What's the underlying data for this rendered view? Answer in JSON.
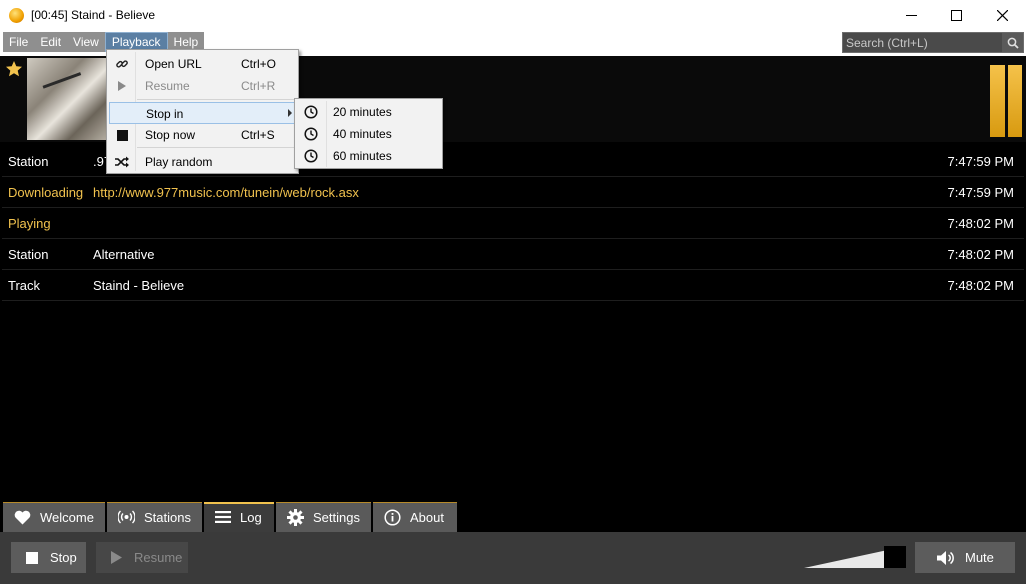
{
  "window": {
    "title": "[00:45] Staind - Believe",
    "minimize_icon": "minimize-icon",
    "maximize_icon": "maximize-icon",
    "close_icon": "close-icon"
  },
  "menubar": {
    "items": [
      "File",
      "Edit",
      "View",
      "Playback",
      "Help"
    ],
    "active": "Playback"
  },
  "search": {
    "placeholder": "Search (Ctrl+L)",
    "value": ""
  },
  "playback_menu": {
    "items": [
      {
        "label": "Open URL",
        "shortcut": "Ctrl+O",
        "icon": "link-icon",
        "enabled": true
      },
      {
        "label": "Resume",
        "shortcut": "Ctrl+R",
        "icon": "play-icon",
        "enabled": false
      },
      {
        "label": "Stop in",
        "shortcut": "",
        "icon": "",
        "enabled": true,
        "submenu": true
      },
      {
        "label": "Stop now",
        "shortcut": "Ctrl+S",
        "icon": "stop-icon",
        "enabled": true
      },
      {
        "label": "Play random",
        "shortcut": "",
        "icon": "shuffle-icon",
        "enabled": true
      }
    ]
  },
  "stop_in_submenu": {
    "items": [
      "20 minutes",
      "40 minutes",
      "60 minutes"
    ],
    "icon": "clock-icon"
  },
  "log": {
    "rows": [
      {
        "key": "Station",
        "value": ".97",
        "time": "7:47:59 PM"
      },
      {
        "key": "Downloading",
        "value": "http://www.977music.com/tunein/web/rock.asx",
        "time": "7:47:59 PM"
      },
      {
        "key": "Playing",
        "value": "",
        "time": "7:48:02 PM"
      },
      {
        "key": "Station",
        "value": "Alternative",
        "time": "7:48:02 PM"
      },
      {
        "key": "Track",
        "value": "Staind - Believe",
        "time": "7:48:02 PM"
      }
    ]
  },
  "tabs": [
    {
      "label": "Welcome",
      "icon": "heart-icon"
    },
    {
      "label": "Stations",
      "icon": "broadcast-icon"
    },
    {
      "label": "Log",
      "icon": "list-icon",
      "active": true
    },
    {
      "label": "Settings",
      "icon": "gear-icon"
    },
    {
      "label": "About",
      "icon": "info-icon"
    }
  ],
  "controls": {
    "stop_label": "Stop",
    "resume_label": "Resume",
    "mute_label": "Mute"
  },
  "colors": {
    "accent": "#f1c24e",
    "background": "#000000",
    "panel": "#3a3a3a"
  }
}
